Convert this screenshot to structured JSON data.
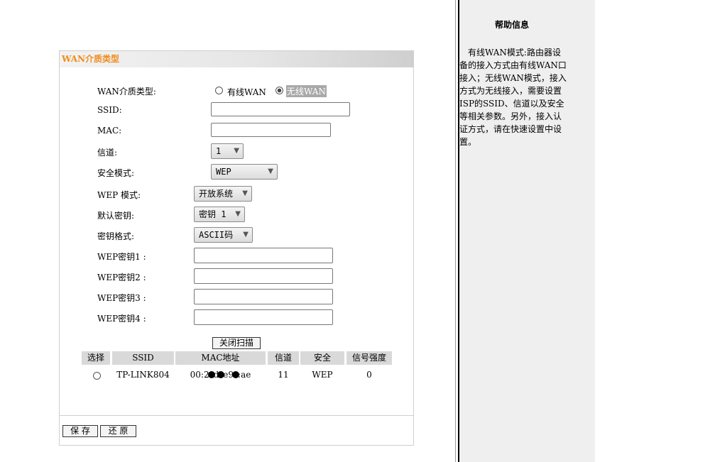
{
  "panel": {
    "title": "WAN介质类型",
    "wan_type": {
      "label": "WAN介质类型:",
      "options": [
        {
          "label": "有线WAN",
          "checked": false
        },
        {
          "label": "无线WAN",
          "checked": true
        }
      ]
    },
    "ssid": {
      "label": "SSID:",
      "value": ""
    },
    "mac": {
      "label": "MAC:",
      "value": ""
    },
    "channel": {
      "label": "信道:",
      "value": "1"
    },
    "security_mode": {
      "label": "安全模式:",
      "value": "WEP"
    },
    "wep_mode": {
      "label": "WEP 模式:",
      "value": "开放系统"
    },
    "default_key": {
      "label": "默认密钥:",
      "value": "密钥 1"
    },
    "key_format": {
      "label": "密钥格式:",
      "value": "ASCII码"
    },
    "wep_keys": [
      {
        "label": "WEP密钥1 :",
        "value": ""
      },
      {
        "label": "WEP密钥2 :",
        "value": ""
      },
      {
        "label": "WEP密钥3 :",
        "value": ""
      },
      {
        "label": "WEP密钥4 :",
        "value": ""
      }
    ],
    "scan_button": "关闭扫描",
    "table": {
      "headers": [
        "选择",
        "SSID",
        "MAC地址",
        "信道",
        "安全",
        "信号强度"
      ],
      "rows": [
        {
          "ssid": "TP-LINK804",
          "mac_prefix": "00:2",
          "mac_mid1": "d",
          "mac_mid2": "e9",
          "mac_suffix": ":ae",
          "channel": "11",
          "security": "WEP",
          "signal": "0"
        }
      ]
    },
    "save_button": "保 存",
    "restore_button": "还 原"
  },
  "help": {
    "title": "帮助信息",
    "text": "有线WAN模式:路由器设备的接入方式由有线WAN口接入；无线WAN模式，接入方式为无线接入，需要设置ISP的SSID、信道以及安全等相关参数。另外，接入认证方式，请在快速设置中设置。"
  },
  "colors": {
    "title_orange": "#f08c1a",
    "header_gray": "#d9d9d9",
    "help_bg": "#efefef"
  }
}
